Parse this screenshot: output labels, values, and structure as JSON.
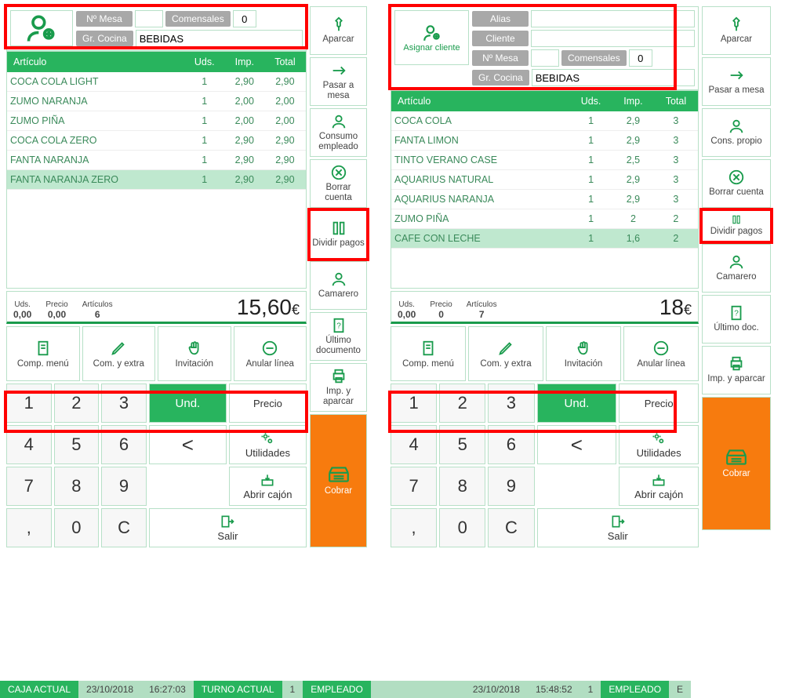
{
  "left": {
    "top": {
      "mesa_lbl": "Nº Mesa",
      "mesa_val": "",
      "com_lbl": "Comensales",
      "com_val": "0",
      "gr_lbl": "Gr. Cocina",
      "gr_val": "BEBIDAS"
    },
    "cols": [
      "Artículo",
      "Uds.",
      "Imp.",
      "Total"
    ],
    "rows": [
      {
        "a": "COCA COLA LIGHT",
        "u": "1",
        "i": "2,90",
        "t": "2,90"
      },
      {
        "a": "ZUMO NARANJA",
        "u": "1",
        "i": "2,00",
        "t": "2,00"
      },
      {
        "a": "ZUMO PIÑA",
        "u": "1",
        "i": "2,00",
        "t": "2,00"
      },
      {
        "a": "COCA COLA ZERO",
        "u": "1",
        "i": "2,90",
        "t": "2,90"
      },
      {
        "a": "FANTA NARANJA",
        "u": "1",
        "i": "2,90",
        "t": "2,90"
      },
      {
        "a": "FANTA NARANJA ZERO",
        "u": "1",
        "i": "2,90",
        "t": "2,90",
        "sel": true
      }
    ],
    "tot": {
      "uds_l": "Uds.",
      "uds": "0,00",
      "pre_l": "Precio",
      "pre": "0,00",
      "art_l": "Artículos",
      "art": "6",
      "big": "15,60",
      "cur": "€"
    },
    "row4": [
      "Comp. menú",
      "Com. y extra",
      "Invitación",
      "Anular línea"
    ],
    "side": [
      "Aparcar",
      "Pasar a mesa",
      "Consumo empleado",
      "Borrar cuenta",
      "Dividir pagos",
      "Camarero",
      "Último documento",
      "Imp. y aparcar"
    ],
    "cobrar": "Cobrar"
  },
  "right": {
    "assign": "Asignar cliente",
    "top": {
      "alias_lbl": "Alias",
      "alias_val": "",
      "cli_lbl": "Cliente",
      "cli_val": "",
      "mesa_lbl": "Nº Mesa",
      "mesa_val": "",
      "com_lbl": "Comensales",
      "com_val": "0",
      "gr_lbl": "Gr. Cocina",
      "gr_val": "BEBIDAS"
    },
    "cols": [
      "Artículo",
      "Uds.",
      "Imp.",
      "Total"
    ],
    "rows": [
      {
        "a": "COCA COLA",
        "u": "1",
        "i": "2,9",
        "t": "3"
      },
      {
        "a": "FANTA LIMON",
        "u": "1",
        "i": "2,9",
        "t": "3"
      },
      {
        "a": "TINTO VERANO CASE",
        "u": "1",
        "i": "2,5",
        "t": "3"
      },
      {
        "a": "AQUARIUS NATURAL",
        "u": "1",
        "i": "2,9",
        "t": "3"
      },
      {
        "a": "AQUARIUS NARANJA",
        "u": "1",
        "i": "2,9",
        "t": "3"
      },
      {
        "a": "ZUMO PIÑA",
        "u": "1",
        "i": "2",
        "t": "2"
      },
      {
        "a": "CAFE CON LECHE",
        "u": "1",
        "i": "1,6",
        "t": "2",
        "sel": true
      }
    ],
    "tot": {
      "uds_l": "Uds.",
      "uds": "0,00",
      "pre_l": "Precio",
      "pre": "0",
      "art_l": "Artículos",
      "art": "7",
      "big": "18",
      "cur": "€"
    },
    "row4": [
      "Comp. menú",
      "Com. y extra",
      "Invitación",
      "Anular línea"
    ],
    "side": [
      "Aparcar",
      "Pasar a mesa",
      "Cons. propio",
      "Borrar cuenta",
      "Dividir pagos",
      "Camarero",
      "Último doc.",
      "Imp. y aparcar"
    ],
    "cobrar": "Cobrar"
  },
  "keys": {
    "nums": [
      "1",
      "2",
      "3",
      "4",
      "5",
      "6",
      "7",
      "8",
      "9",
      ",",
      "0",
      "C"
    ],
    "und": "Und.",
    "precio": "Precio",
    "lt": "<",
    "util": "Utilidades",
    "abrir": "Abrir cajón",
    "salir": "Salir"
  },
  "status": {
    "caja": "CAJA ACTUAL",
    "date": "23/10/2018",
    "time1": "16:27:03",
    "turno": "TURNO ACTUAL",
    "tn": "1",
    "emp": "EMPLEADO"
  },
  "status2": {
    "time": "15:48:52",
    "en": "1",
    "emp": "EMPLEADO",
    "e": "E"
  }
}
